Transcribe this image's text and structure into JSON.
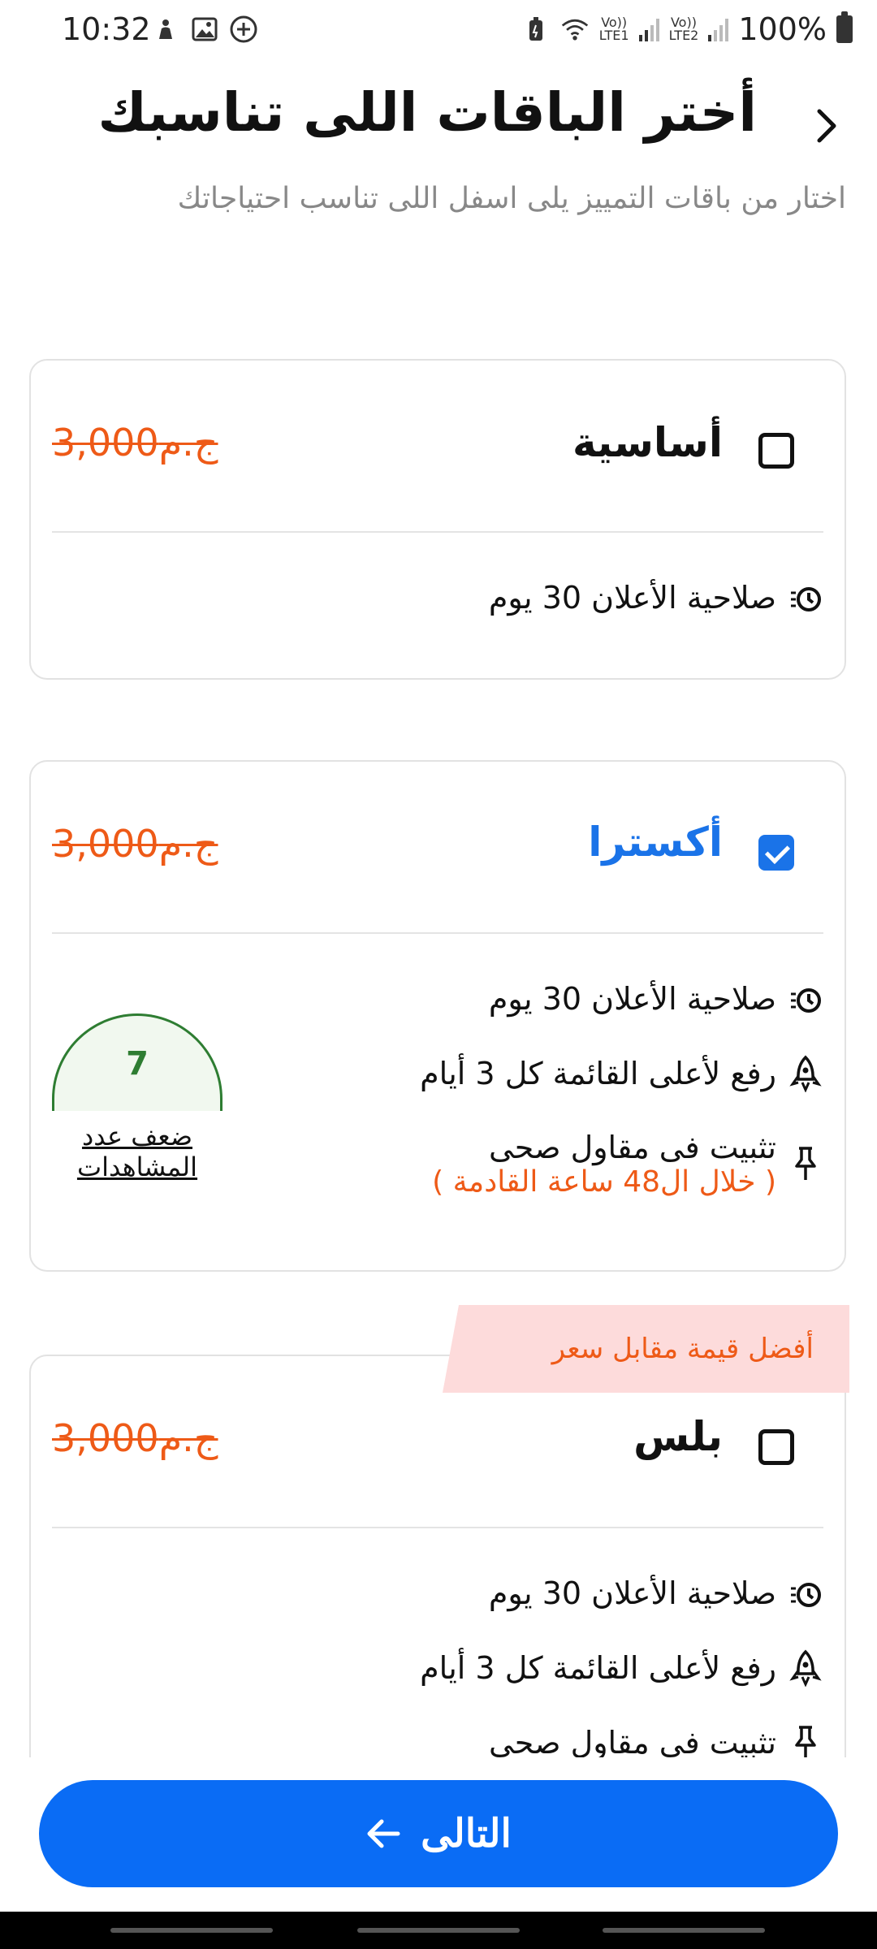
{
  "status_bar": {
    "time": "10:32",
    "left_icons": [
      "accessibility-icon",
      "image-icon",
      "add-circle-icon"
    ],
    "sim1": "Vo))\nLTE1",
    "sim2": "Vo))\nLTE2",
    "battery": "100%"
  },
  "header": {
    "title": "أختر الباقات اللى تناسبك",
    "subtitle": "اختار من باقات التمييز يلى اسفل اللى تناسب احتياجاتك",
    "back_icon": "chevron-icon"
  },
  "packages": [
    {
      "name": "أساسية",
      "price": "3,000ج.م",
      "checked": false,
      "features": [
        {
          "icon": "timer-icon",
          "text": "صلاحية الأعلان 30 يوم"
        }
      ]
    },
    {
      "name": "أكسترا",
      "price": "3,000ج.م",
      "checked": true,
      "views_multiplier": "7",
      "views_label": "ضعف عدد المشاهدات",
      "features": [
        {
          "icon": "timer-icon",
          "text": "صلاحية الأعلان 30 يوم"
        },
        {
          "icon": "rocket-icon",
          "text": "رفع لأعلى القائمة كل 3 أيام"
        },
        {
          "icon": "pin-icon",
          "text": "تثبيت فى مقاول صحى",
          "sub": "( خلال ال48 ساعة القادمة )"
        }
      ]
    },
    {
      "name": "بلس",
      "price": "3,000ج.م",
      "checked": false,
      "badge": "أفضل قيمة مقابل سعر",
      "features": [
        {
          "icon": "timer-icon",
          "text": "صلاحية الأعلان 30 يوم"
        },
        {
          "icon": "rocket-icon",
          "text": "رفع لأعلى القائمة كل 3 أيام"
        },
        {
          "icon": "pin-icon",
          "text": "تثبيت فى مقاول صحى"
        }
      ]
    }
  ],
  "footer": {
    "next_label": "التالى",
    "next_icon": "arrow-left-icon"
  },
  "colors": {
    "accent": "#0a6cf5",
    "price": "#ee5a17",
    "badge_bg": "#fddbdb",
    "views_green": "#2e7d32"
  }
}
